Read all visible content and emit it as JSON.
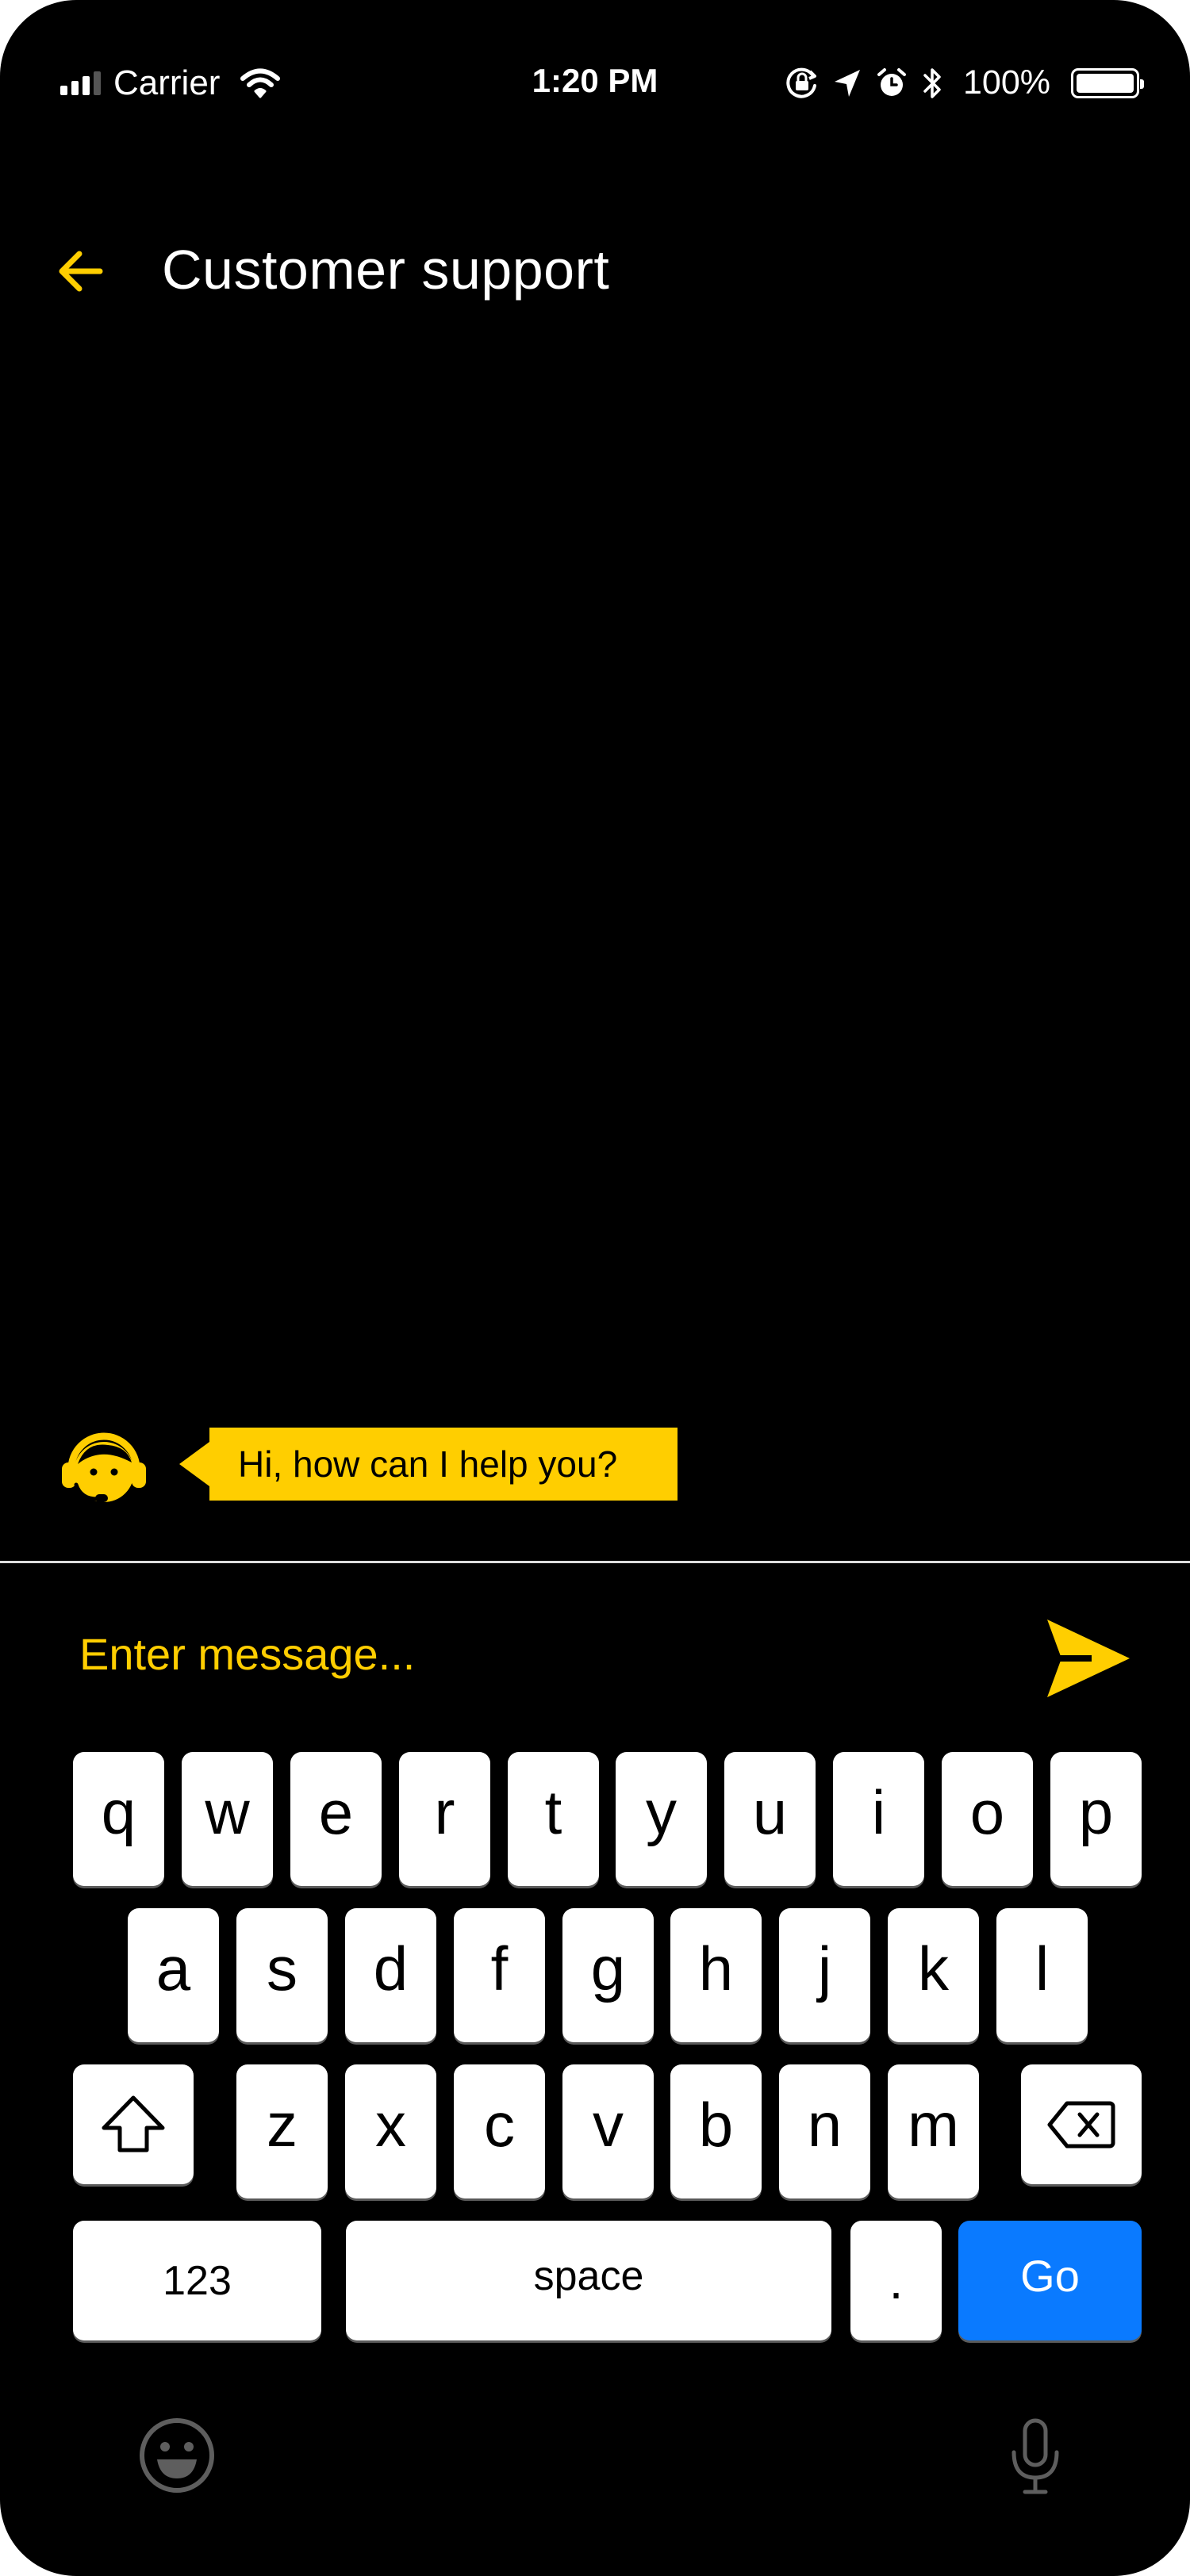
{
  "status_bar": {
    "carrier": "Carrier",
    "time": "1:20 PM",
    "battery_percent": "100%",
    "icons": [
      "signal-icon",
      "wifi-icon",
      "orientation-lock-icon",
      "location-arrow-icon",
      "alarm-icon",
      "bluetooth-icon",
      "battery-icon"
    ]
  },
  "header": {
    "title": "Customer support",
    "back_icon": "back-arrow-icon"
  },
  "chat": {
    "messages": [
      {
        "sender": "agent",
        "avatar_icon": "support-agent-headset-icon",
        "text": "Hi, how can I help you?"
      }
    ]
  },
  "composer": {
    "placeholder": "Enter message...",
    "value": "",
    "send_icon": "send-icon"
  },
  "keyboard": {
    "row1": [
      "q",
      "w",
      "e",
      "r",
      "t",
      "y",
      "u",
      "i",
      "o",
      "p"
    ],
    "row2": [
      "a",
      "s",
      "d",
      "f",
      "g",
      "h",
      "j",
      "k",
      "l"
    ],
    "row3": [
      "z",
      "x",
      "c",
      "v",
      "b",
      "n",
      "m"
    ],
    "numbers_label": "123",
    "space_label": "space",
    "period_label": ".",
    "go_label": "Go",
    "shift_icon": "shift-icon",
    "delete_icon": "backspace-icon",
    "emoji_icon": "emoji-icon",
    "mic_icon": "microphone-icon"
  },
  "colors": {
    "accent": "#FFCE00",
    "background": "#000000",
    "go_key": "#0A7AFF",
    "key": "#FFFFFF"
  }
}
